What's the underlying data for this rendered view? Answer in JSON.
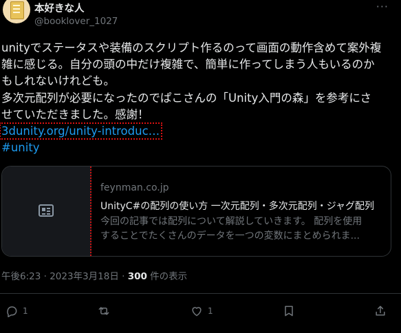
{
  "author": {
    "display_name": "本好きな人",
    "handle": "@booklover_1027",
    "more_label": "···"
  },
  "tweet": {
    "text": "unityでステータスや装備のスクリプト作るのって画面の動作含めて案外複\n雑に感じる。自分の頭の中だけ複雑で、簡単に作ってしまう人もいるのか\nもしれないけれども。\n多次元配列が必要になったのでぱこさんの「Unity入門の森」を参考にさ\nせていただきました。感謝！",
    "link": "3dunity.org/unity-introduc…",
    "hashtag": "#unity"
  },
  "card": {
    "domain": "feynman.co.jp",
    "title": "UnityC#の配列の使い方 一次元配列・多次元配列・ジャグ配列",
    "desc_line1": "今回の記事では配列について解説していきます。 配列を使用",
    "desc_line2": "することでたくさんのデータを一つの変数にまとめられま..."
  },
  "meta": {
    "time_date": "午後6:23 · 2023年3月18日 · ",
    "views_count": "300",
    "views_label": " 件の表示"
  },
  "actions": {
    "reply_count": "1",
    "like_count": "1"
  },
  "colors": {
    "background": "#000000",
    "text": "#e7e9ea",
    "secondary": "#71767b",
    "link": "#1d9bf0",
    "border": "#2f3336"
  }
}
